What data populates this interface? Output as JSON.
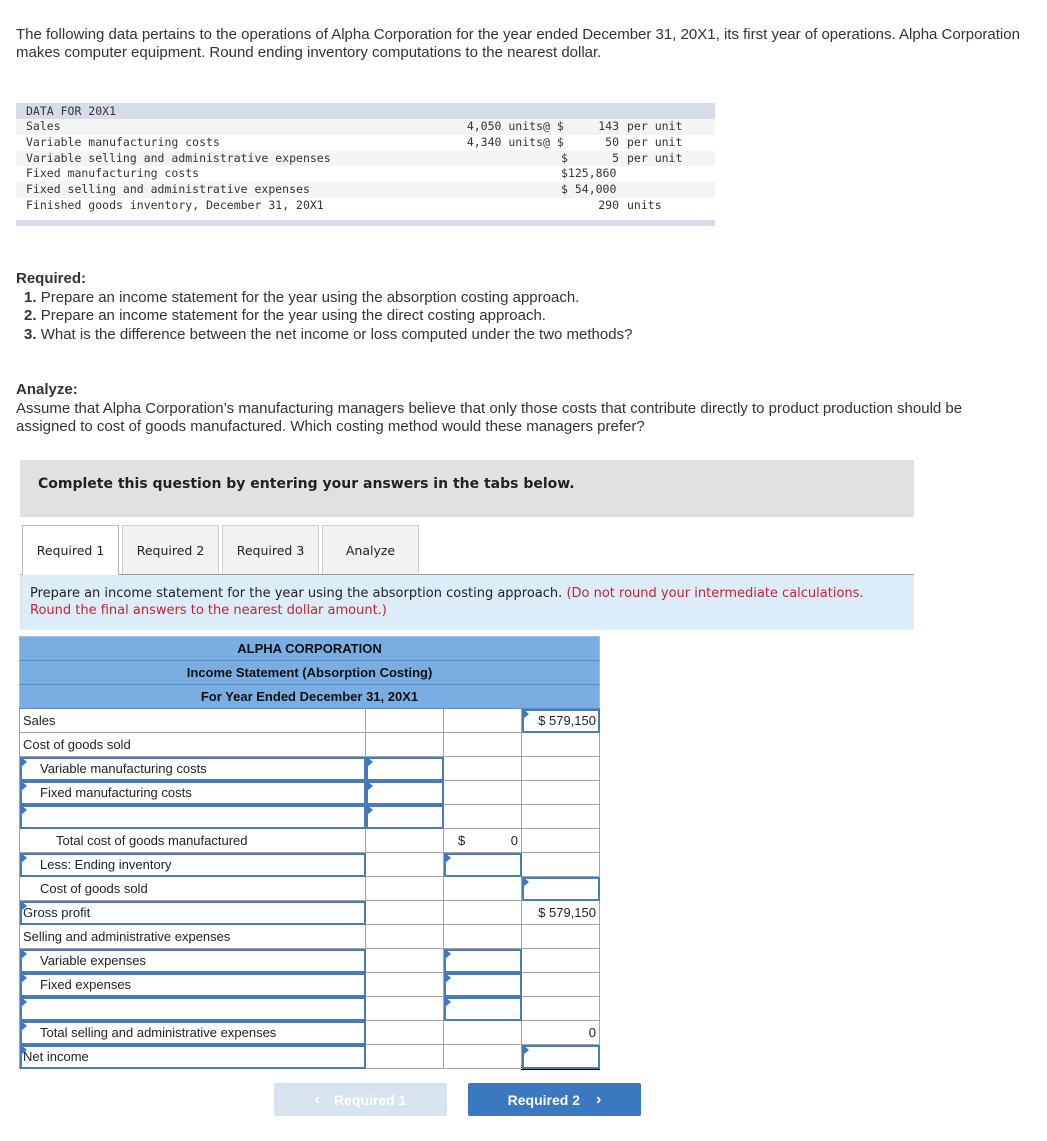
{
  "intro": "The following data pertains to the operations of Alpha Corporation for the year ended December 31, 20X1, its first year of operations. Alpha Corporation makes computer equipment. Round ending inventory computations to the nearest dollar.",
  "data_table": {
    "header": "DATA FOR 20X1",
    "rows": [
      {
        "label": "Sales",
        "units": "4,050 units",
        "at": "@ $",
        "amount": "143",
        "per": "per unit"
      },
      {
        "label": "Variable manufacturing costs",
        "units": "4,340 units",
        "at": "@ $",
        "amount": "50",
        "per": "per unit"
      },
      {
        "label": "Variable selling and administrative expenses",
        "units": "",
        "at": "$",
        "amount": "5",
        "per": "per unit"
      },
      {
        "label": "Fixed manufacturing costs",
        "units": "",
        "at": "",
        "amount": "$125,860",
        "per": ""
      },
      {
        "label": "Fixed selling and administrative expenses",
        "units": "",
        "at": "",
        "amount": "$ 54,000",
        "per": ""
      },
      {
        "label": "Finished goods inventory, December 31, 20X1",
        "units": "",
        "at": "",
        "amount": "290",
        "per": "units"
      }
    ]
  },
  "required": {
    "heading": "Required:",
    "items": [
      {
        "num": "1.",
        "text": "Prepare an income statement for the year using the absorption costing approach."
      },
      {
        "num": "2.",
        "text": "Prepare an income statement for the year using the direct costing approach."
      },
      {
        "num": "3.",
        "text": "What is the difference between the net income or loss computed under the two methods?"
      }
    ]
  },
  "analyze": {
    "heading": "Analyze:",
    "text": "Assume that Alpha Corporation’s manufacturing managers believe that only those costs that contribute directly to product production should be assigned to cost of goods manufactured. Which costing method would these managers prefer?"
  },
  "instruction_box": "Complete this question by entering your answers in the tabs below.",
  "tabs": [
    {
      "label": "Required 1",
      "active": true
    },
    {
      "label": "Required 2",
      "active": false
    },
    {
      "label": "Required 3",
      "active": false
    },
    {
      "label": "Analyze",
      "active": false
    }
  ],
  "prompt": {
    "text": "Prepare an income statement for the year using the absorption costing approach.",
    "note": "(Do not round your intermediate calculations. Round the final answers to the nearest dollar amount.)"
  },
  "statement": {
    "title1": "ALPHA CORPORATION",
    "title2": "Income Statement (Absorption Costing)",
    "title3": "For Year Ended December 31, 20X1",
    "rows": [
      {
        "label": "Sales",
        "c1": "",
        "c2": "",
        "c3": "$ 579,150"
      },
      {
        "label": "Cost of goods sold",
        "c1": "",
        "c2": "",
        "c3": ""
      },
      {
        "label": "Variable manufacturing costs",
        "c1": "",
        "c2": "",
        "c3": ""
      },
      {
        "label": "Fixed manufacturing costs",
        "c1": "",
        "c2": "",
        "c3": ""
      },
      {
        "label": "",
        "c1": "",
        "c2": "",
        "c3": ""
      },
      {
        "label": "Total cost of goods manufactured",
        "c1": "",
        "c2_dollar": "$",
        "c2": "0",
        "c3": ""
      },
      {
        "label": "Less: Ending inventory",
        "c1": "",
        "c2": "",
        "c3": ""
      },
      {
        "label": "Cost of goods sold",
        "c1": "",
        "c2": "",
        "c3": ""
      },
      {
        "label": "Gross profit",
        "c1": "",
        "c2": "",
        "c3": "$ 579,150"
      },
      {
        "label": "Selling and administrative expenses",
        "c1": "",
        "c2": "",
        "c3": ""
      },
      {
        "label": "Variable expenses",
        "c1": "",
        "c2": "",
        "c3": ""
      },
      {
        "label": "Fixed expenses",
        "c1": "",
        "c2": "",
        "c3": ""
      },
      {
        "label": "",
        "c1": "",
        "c2": "",
        "c3": ""
      },
      {
        "label": "Total selling and administrative expenses",
        "c1": "",
        "c2": "",
        "c3": "0"
      },
      {
        "label": "Net income",
        "c1": "",
        "c2": "",
        "c3": ""
      }
    ]
  },
  "nav": {
    "prev_label": "Required 1",
    "next_label": "Required 2",
    "prev_icon": "‹",
    "next_icon": "›"
  }
}
